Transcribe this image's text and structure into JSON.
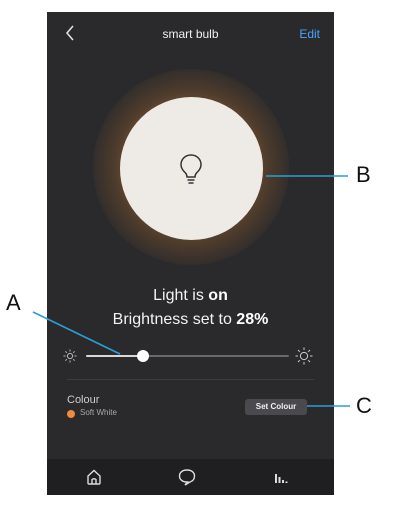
{
  "header": {
    "title": "smart bulb",
    "edit_label": "Edit",
    "back_icon": "chevron-left-icon"
  },
  "bulb": {
    "icon": "lightbulb-icon",
    "glow_color": "#a86c3c",
    "face_color": "#eeeae6"
  },
  "status": {
    "light_prefix": "Light is ",
    "light_state": "on",
    "brightness_prefix": "Brightness set to ",
    "brightness_value": "28%"
  },
  "brightness": {
    "value": 0.28,
    "min_icon": "sun-small-icon",
    "max_icon": "sun-large-icon"
  },
  "colour": {
    "label": "Colour",
    "value": "Soft White",
    "swatch": "#f08a3c",
    "button_label": "Set Colour"
  },
  "nav": {
    "items": [
      "home-icon",
      "chat-icon",
      "stats-icon"
    ]
  },
  "callouts": {
    "a": "A",
    "b": "B",
    "c": "C"
  },
  "accent": "#4aa3ff"
}
